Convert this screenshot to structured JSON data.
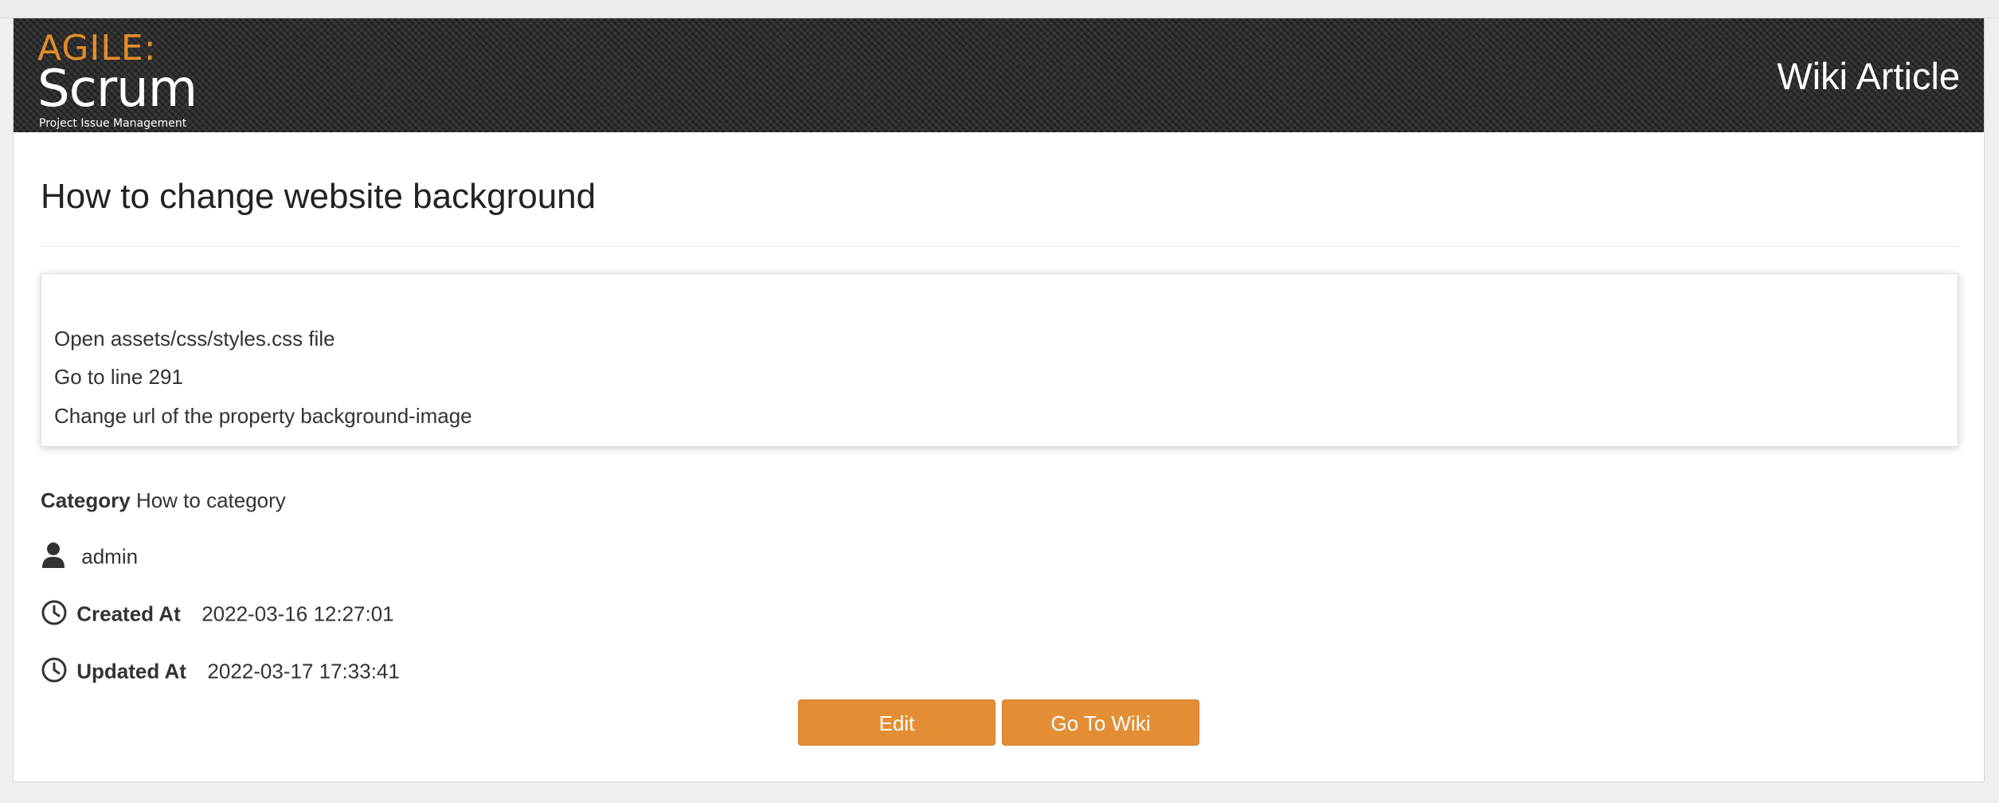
{
  "logo": {
    "agile": "AGILE:",
    "scrum": "Scrum",
    "tagline": "Project Issue Management"
  },
  "header": {
    "title": "Wiki Article"
  },
  "article": {
    "title": "How to change website background",
    "body_lines": [
      "Open assets/css/styles.css file",
      "Go to line 291",
      "Change url of the property background-image"
    ]
  },
  "meta": {
    "category_label": "Category",
    "category_value": "How to category",
    "author": "admin",
    "created_label": "Created At",
    "created_value": "2022-03-16 12:27:01",
    "updated_label": "Updated At",
    "updated_value": "2022-03-17 17:33:41"
  },
  "actions": {
    "edit_label": "Edit",
    "wiki_label": "Go To Wiki"
  },
  "icons": {
    "author": "user-icon",
    "created": "clock-icon",
    "updated": "clock-icon"
  },
  "colors": {
    "accent": "#e38e34",
    "header_bg": "#2f2f2f"
  }
}
